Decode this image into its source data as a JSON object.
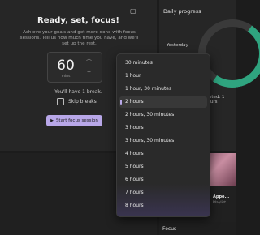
{
  "focus": {
    "title": "Ready, set, focus!",
    "subtitle": "Achieve your goals and get more done with focus sessions. Tell us how much time you have, and we'll set up the rest.",
    "minutes_value": "60",
    "minutes_unit": "mins",
    "break_text": "You'll have 1 break.",
    "skip_breaks_label": "Skip breaks",
    "start_button_label": "Start focus session"
  },
  "daily_progress": {
    "title": "Daily progress",
    "yesterday_label": "Yesterday",
    "completed_label": "pleted: 1 hours"
  },
  "spotify": {
    "title": "Appo...",
    "subtitle": "Playlist"
  },
  "bottom": {
    "focus_label": "Focus"
  },
  "dropdown": {
    "options": [
      "30 minutes",
      "1 hour",
      "1 hour, 30 minutes",
      "2 hours",
      "2 hours, 30 minutes",
      "3 hours",
      "3 hours, 30 minutes",
      "4 hours",
      "5 hours",
      "6 hours",
      "7 hours",
      "8 hours"
    ],
    "selected": "2 hours"
  },
  "icons": {
    "window_icon": "▢",
    "more_icon": "⋯",
    "up_icon": "︿",
    "down_icon": "﹀",
    "play_icon": "▶"
  },
  "colors": {
    "accent": "#b8a7e8",
    "progress_ring": "#2fa47f"
  }
}
